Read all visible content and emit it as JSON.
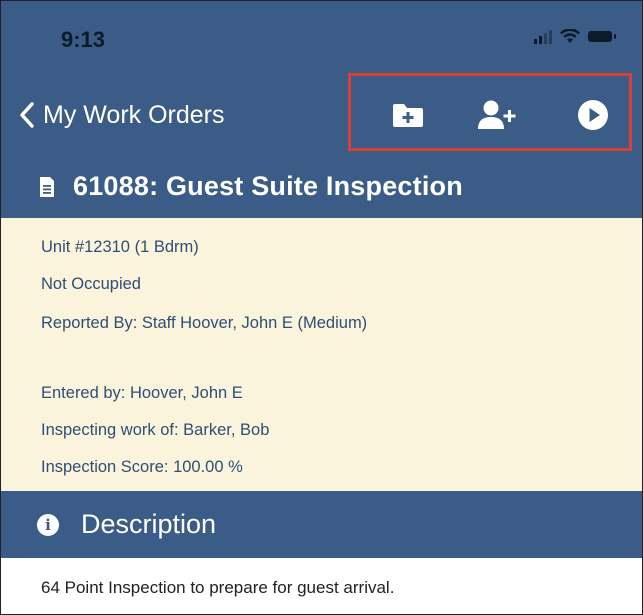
{
  "status_bar": {
    "time": "9:13"
  },
  "nav": {
    "back_label": "My Work Orders",
    "actions": [
      {
        "name": "add-folder-button",
        "icon": "folder-plus-icon"
      },
      {
        "name": "add-user-button",
        "icon": "user-plus-icon"
      },
      {
        "name": "start-button",
        "icon": "play-circle-icon"
      }
    ]
  },
  "work_order": {
    "title": "61088: Guest Suite Inspection",
    "unit": "Unit #12310 (1 Bdrm)",
    "occupancy": "Not Occupied",
    "reported_by": "Reported By: Staff Hoover, John E (Medium)",
    "entered_by": "Entered by: Hoover, John E",
    "inspecting_work_of": "Inspecting work of: Barker, Bob",
    "inspection_score": "Inspection Score:  100.00 %"
  },
  "description": {
    "header": "Description",
    "text": "64 Point Inspection to prepare for guest arrival."
  },
  "colors": {
    "header_blue": "#3b5c87",
    "detail_background": "#fbf4dd",
    "detail_text": "#2f4e75",
    "highlight_red": "#d9403a"
  }
}
